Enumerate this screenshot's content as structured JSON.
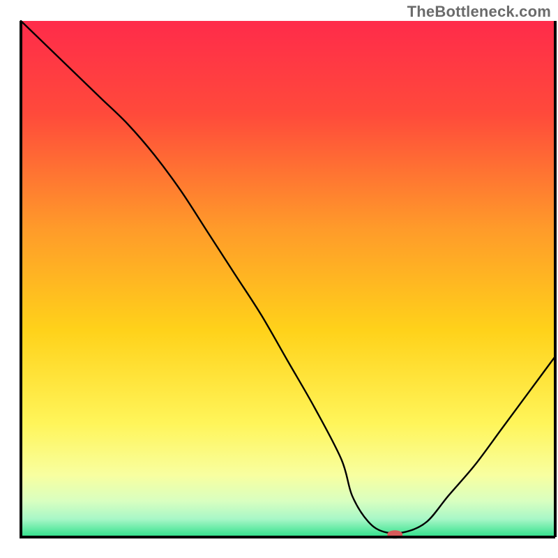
{
  "watermark": {
    "text": "TheBottleneck.com"
  },
  "chart_data": {
    "type": "line",
    "title": "",
    "xlabel": "",
    "ylabel": "",
    "xlim": [
      0,
      100
    ],
    "ylim": [
      0,
      100
    ],
    "x": [
      0,
      5,
      10,
      15,
      20,
      25,
      30,
      35,
      40,
      45,
      50,
      55,
      60,
      62,
      65,
      68,
      72,
      76,
      80,
      85,
      90,
      95,
      100
    ],
    "values": [
      100,
      95,
      90,
      85,
      80,
      74,
      67,
      59,
      51,
      43,
      34,
      25,
      15,
      8,
      3,
      1,
      1,
      3,
      8,
      14,
      21,
      28,
      35
    ],
    "background": {
      "gradient": {
        "stops": [
          {
            "offset": 0.0,
            "color": "#ff2b4a"
          },
          {
            "offset": 0.18,
            "color": "#ff4a3b"
          },
          {
            "offset": 0.4,
            "color": "#ff9a2a"
          },
          {
            "offset": 0.6,
            "color": "#ffd21a"
          },
          {
            "offset": 0.78,
            "color": "#fff55a"
          },
          {
            "offset": 0.88,
            "color": "#f8ffa0"
          },
          {
            "offset": 0.93,
            "color": "#d9ffc0"
          },
          {
            "offset": 0.965,
            "color": "#a8f7c7"
          },
          {
            "offset": 1.0,
            "color": "#2fe08a"
          }
        ]
      }
    },
    "marker": {
      "x": 70,
      "y": 0.5,
      "color": "#d85a5a",
      "rx": 11,
      "ry": 6
    },
    "axes_color": "#000000"
  }
}
